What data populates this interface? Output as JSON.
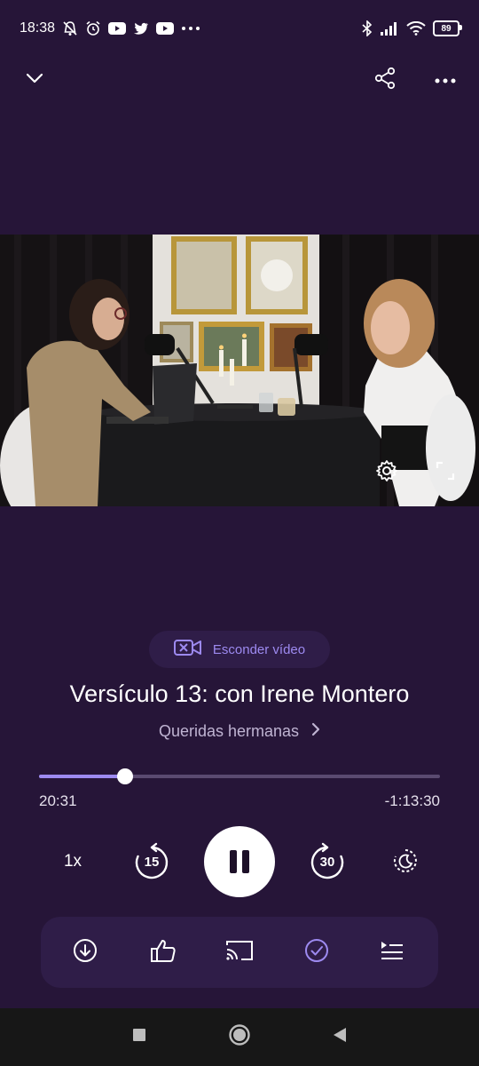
{
  "status_bar": {
    "time": "18:38",
    "battery": "89",
    "icons_left": [
      "notifications-off-icon",
      "alarm-icon",
      "youtube-icon",
      "twitter-icon",
      "youtube-icon",
      "more-dots-icon"
    ],
    "icons_right": [
      "bluetooth-icon",
      "signal-icon",
      "wifi-icon",
      "battery-icon"
    ]
  },
  "top_bar": {
    "icons": [
      "chevron-down-icon",
      "share-icon",
      "more-options-icon"
    ]
  },
  "video": {
    "controls_icons": [
      "settings-gear-icon",
      "fullscreen-icon"
    ]
  },
  "hide_video": {
    "label": "Esconder vídeo",
    "icon": "video-off-icon"
  },
  "episode": {
    "title": "Versículo 13: con Irene Montero",
    "show": "Queridas hermanas"
  },
  "progress": {
    "elapsed": "20:31",
    "remaining": "-1:13:30",
    "fraction": 0.215
  },
  "controls": {
    "speed": "1x",
    "rewind_seconds": "15",
    "forward_seconds": "30",
    "state": "playing"
  },
  "actions": {
    "icons": [
      "download-icon",
      "like-icon",
      "cast-icon",
      "mark-played-icon",
      "queue-icon"
    ]
  },
  "colors": {
    "background": "#261538",
    "accent": "#9d8af0",
    "surface": "#2f1d48"
  }
}
